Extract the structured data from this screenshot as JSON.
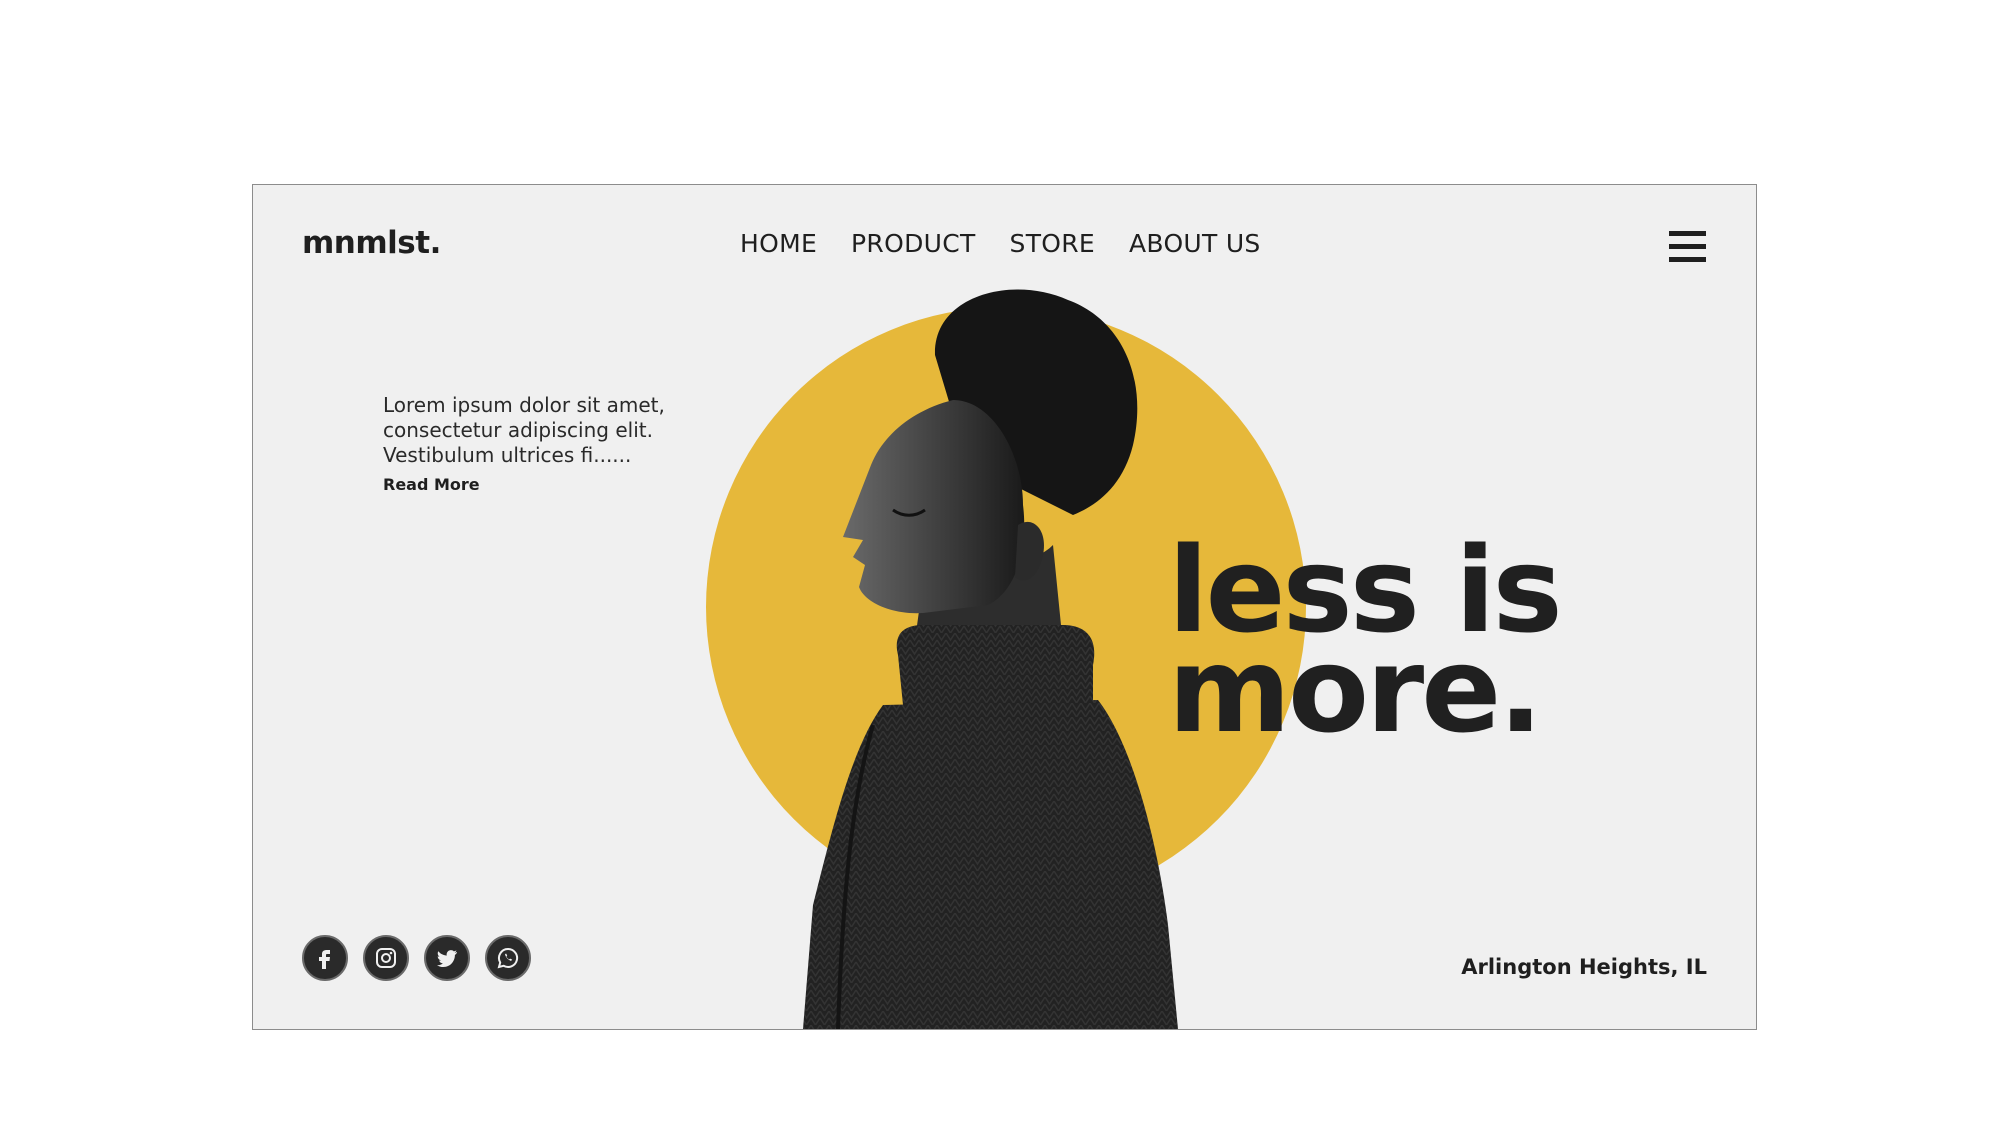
{
  "brand": {
    "logo": "mnmlst."
  },
  "nav": {
    "items": [
      {
        "label": "HOME"
      },
      {
        "label": "PRODUCT"
      },
      {
        "label": "STORE"
      },
      {
        "label": "ABOUT US"
      }
    ],
    "menu_icon": "hamburger-menu-icon"
  },
  "intro": {
    "text": "Lorem ipsum dolor sit amet, consectetur adipiscing elit. Vestibulum ultrices fi......",
    "read_more": "Read More"
  },
  "hero": {
    "headline_line1": "less is",
    "headline_line2": "more.",
    "image": "profile-portrait-man-turtleneck",
    "accent_color": "#e6b83a"
  },
  "socials": [
    {
      "icon": "facebook-icon"
    },
    {
      "icon": "instagram-icon"
    },
    {
      "icon": "twitter-icon"
    },
    {
      "icon": "whatsapp-icon"
    }
  ],
  "footer": {
    "location": "Arlington Heights, IL"
  }
}
